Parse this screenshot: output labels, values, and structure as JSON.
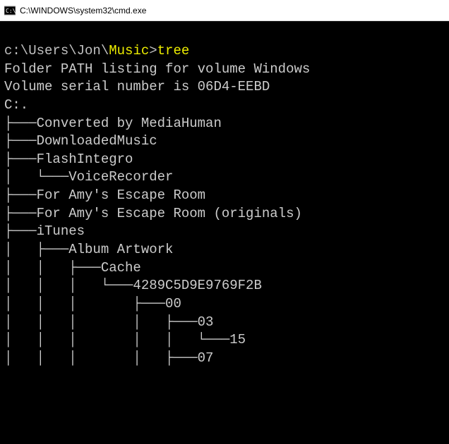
{
  "window": {
    "title": "C:\\WINDOWS\\system32\\cmd.exe"
  },
  "prompt": {
    "path": "c:\\Users\\Jon\\",
    "dir": "Music",
    "arrow": ">",
    "command": "tree"
  },
  "output": {
    "line1": "Folder PATH listing for volume Windows",
    "line2": "Volume serial number is 06D4-EEBD",
    "root": "C:.",
    "tree": {
      "l01": "├───Converted by MediaHuman",
      "l02": "├───DownloadedMusic",
      "l03": "├───FlashIntegro",
      "l04": "│   └───VoiceRecorder",
      "l05": "├───For Amy's Escape Room",
      "l06": "├───For Amy's Escape Room (originals)",
      "l07": "├───iTunes",
      "l08": "│   ├───Album Artwork",
      "l09": "│   │   ├───Cache",
      "l10": "│   │   │   └───4289C5D9E9769F2B",
      "l11": "│   │   │       ├───00",
      "l12": "│   │   │       │   ├───03",
      "l13": "│   │   │       │   │   └───15",
      "l14": "│   │   │       │   ├───07"
    }
  }
}
